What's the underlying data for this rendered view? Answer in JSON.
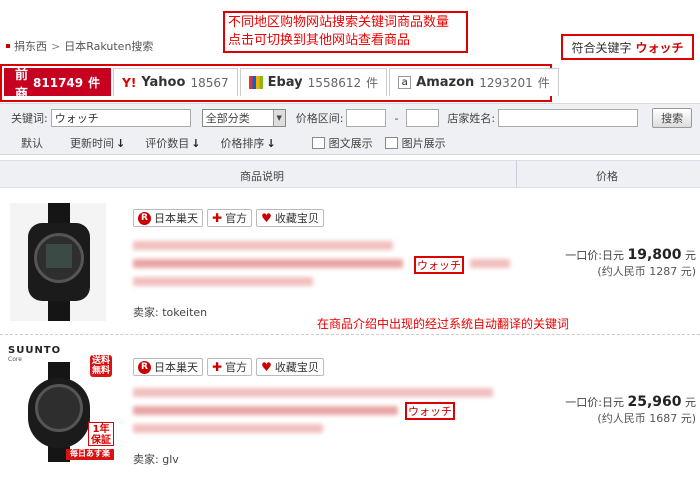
{
  "breadcrumb": {
    "home": "捐东西",
    "separator": ">",
    "current": "日本Rakuten搜索"
  },
  "annotations": {
    "top": "不同地区购物网站搜索关键词商品数量\n点击可切换到其他网站查看商品",
    "middle": "在商品介绍中出现的经过系统自动翻译的关键词"
  },
  "match": {
    "label": "符合关键字",
    "keyword": "ウォッチ"
  },
  "tabs": [
    {
      "label": "当前商品",
      "count": "811749",
      "unit": "件",
      "active": true
    },
    {
      "brand": "Yahoo",
      "icon": "yahoo-icon",
      "count": "18567"
    },
    {
      "brand": "Ebay",
      "icon": "ebay-icon",
      "count": "1558612",
      "unit": "件"
    },
    {
      "brand": "Amazon",
      "icon": "amazon-icon",
      "count": "1293201",
      "unit": "件"
    }
  ],
  "filters": {
    "keyword_label": "关键词:",
    "keyword_value": "ウォッチ",
    "category_value": "全部分类",
    "price_label": "价格区间:",
    "price_sep": "-",
    "shop_label": "店家姓名:",
    "search_button": "搜索",
    "sorts": [
      "默认",
      "更新时间",
      "评价数目",
      "价格排序"
    ],
    "views": [
      "图文展示",
      "图片展示"
    ]
  },
  "columns": {
    "desc": "商品说明",
    "price": "价格"
  },
  "products": [
    {
      "tags": [
        "日本巢天",
        "官方",
        "收藏宝贝"
      ],
      "keyword": "ウォッチ",
      "seller_label": "卖家:",
      "seller": "tokeiten",
      "price_label": "一口价:日元",
      "price": "19,800",
      "price_unit": "元",
      "cny": "(约人民币 1287 元)"
    },
    {
      "tags": [
        "日本巢天",
        "官方",
        "收藏宝贝"
      ],
      "keyword": "ウォッチ",
      "seller_label": "卖家:",
      "seller": "glv",
      "price_label": "一口价:日元",
      "price": "25,960",
      "price_unit": "元",
      "cny": "(约人民币 1687 元)",
      "brand_text": "SUUNTO",
      "brand_sub": "Core",
      "badge_free": "送料\n無料",
      "badge_warranty": "1年\n保証",
      "badge_next": "毎日あす楽"
    }
  ],
  "colors": {
    "accent": "#c8001f",
    "annotation": "#dd0000"
  }
}
